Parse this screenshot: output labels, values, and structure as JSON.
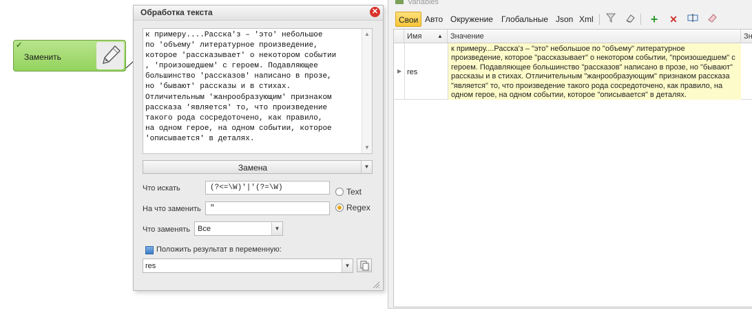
{
  "node": {
    "label": "Заменить"
  },
  "dialog": {
    "title": "Обработка текста",
    "input_text": "к примеру....Расска'з – 'это' небольшое\nпо 'объему' литературное произведение,\nкоторое 'рассказывает' о некотором событии\n, 'произошедшем' с героем. Подавляющее\nбольшинство 'рассказов' написано в прозе,\nно 'бывают' рассказы и в стихах.\nОтличительным 'жанрообразующим' признаком\nрассказа 'является' то, что произведение\nтакого рода сосредоточено, как правило,\nна одном герое, на одном событии, которое\n'описывается' в деталях.",
    "mode": "Замена",
    "find_label": "Что искать",
    "find_value": "(?<=\\W)'|'(?=\\W)",
    "replace_label": "На что заменить",
    "replace_value": "\"",
    "what_label": "Что заменять",
    "what_value": "Все",
    "radio_text": "Text",
    "radio_regex": "Regex",
    "result_checkbox_label": "Положить результат в переменную:",
    "result_variable": "res"
  },
  "variables": {
    "window_title": "Variables",
    "tabs": [
      "Свои",
      "Авто",
      "Окружение",
      "Глобальные",
      "Json",
      "Xml"
    ],
    "active_tab": "Свои",
    "toolbar_icons": [
      "filter-icon",
      "eraser-icon",
      "add-icon",
      "delete-icon",
      "rename-icon",
      "clear-icon"
    ],
    "columns": {
      "name": "Имя",
      "value": "Значение",
      "extra": "Зна"
    },
    "rows": [
      {
        "name": "res",
        "value": "к примеру....Расска'з – \"это\" небольшое по \"объему\" литературное произведение, которое \"рассказывает\" о некотором событии, \"произошедшем\" с героем. Подавляющее большинство \"рассказов\" написано в прозе, но \"бывают\" рассказы и в стихах. Отличительным \"жанрообразующим\" признаком рассказа \"является\" то, что произведение такого рода сосредоточено, как правило, на одном герое, на одном событии, которое \"описывается\" в деталях."
      }
    ]
  },
  "colors": {
    "node_green": "#94d35e",
    "active_tab": "#f7c637",
    "value_highlight": "#fdfbc9",
    "close_red": "#d9312a"
  }
}
